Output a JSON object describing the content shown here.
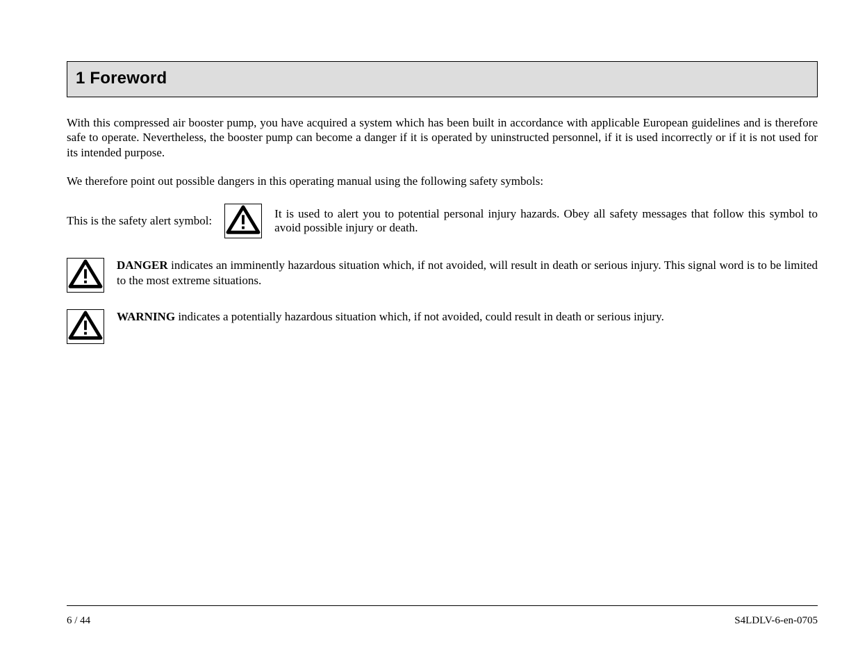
{
  "title": "1  Foreword",
  "intro1": "With this compressed air booster pump, you have acquired a system which has been built in accordance with applicable European guidelines and is therefore safe to operate. Nevertheless, the booster pump can become a danger if it is operated by uninstructed personnel, if it is used incorrectly or if it is not used for its intended purpose.",
  "intro2": "We therefore point out possible dangers in this operating manual using the following safety symbols:",
  "signalLead": "This is the safety alert symbol:",
  "signalTail": "It is used to alert you to potential personal injury hazards. Obey all safety messages that follow this symbol to avoid possible injury or death.",
  "danger": {
    "label": "DANGER",
    "text": " indicates an imminently hazardous situation which, if not avoided, will result in death or serious injury. This signal word is to be limited to the most extreme situations."
  },
  "warning": {
    "label": "WARNING",
    "text": " indicates a potentially hazardous situation which, if not avoided, could result in death or serious injury."
  },
  "footer": {
    "left": "6 / 44",
    "right": "S4LDLV-6-en-0705"
  },
  "icon_name": "hazard-warning-icon"
}
